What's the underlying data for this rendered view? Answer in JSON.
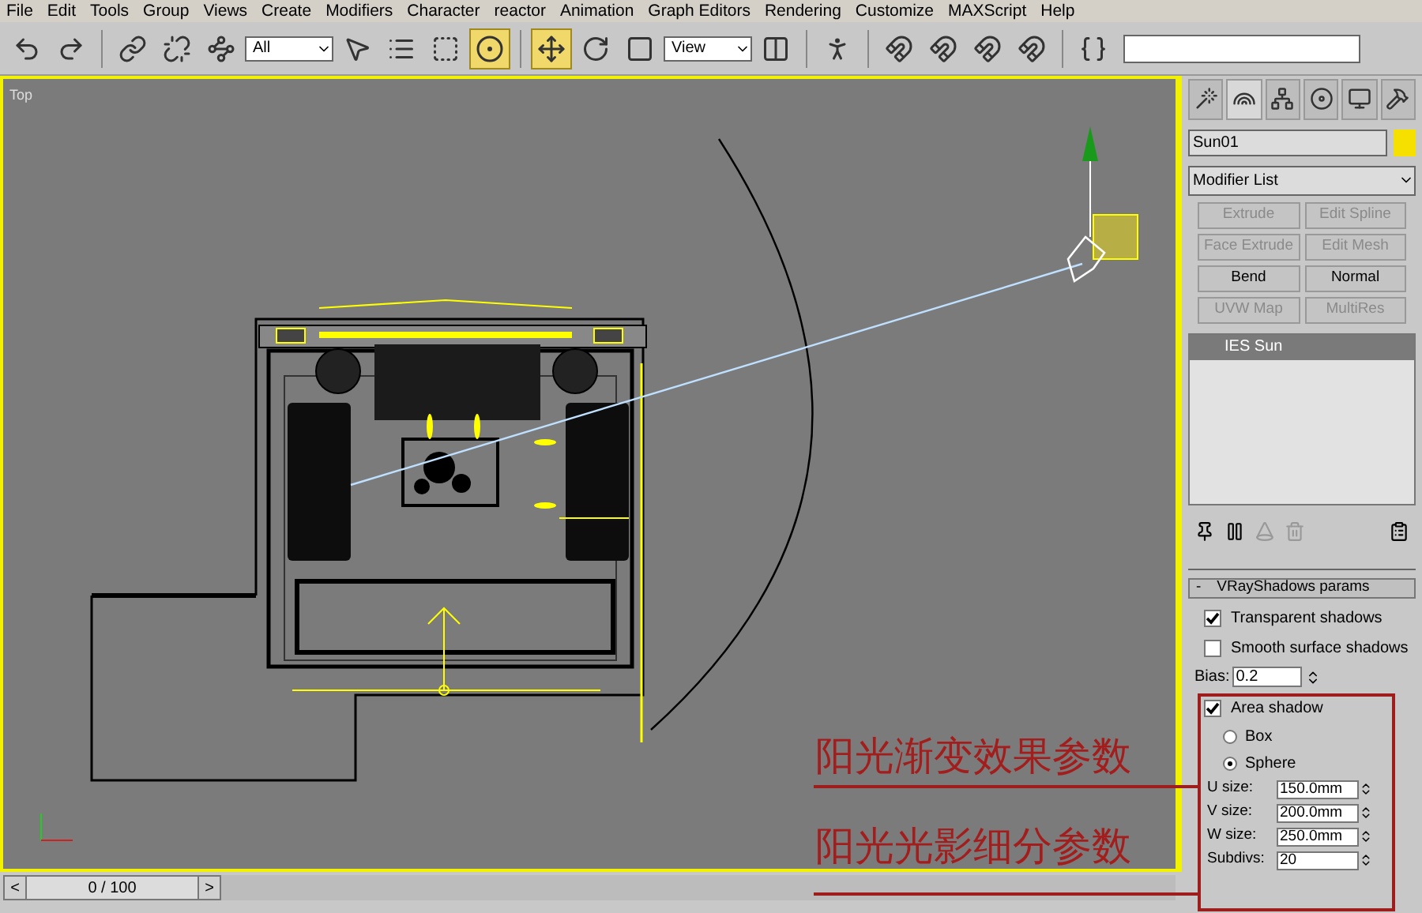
{
  "menu": [
    "File",
    "Edit",
    "Tools",
    "Group",
    "Views",
    "Create",
    "Modifiers",
    "Character",
    "reactor",
    "Animation",
    "Graph Editors",
    "Rendering",
    "Customize",
    "MAXScript",
    "Help"
  ],
  "toolbar": {
    "selection_filter": "All",
    "coordinate_system": "View"
  },
  "viewport": {
    "label": "Top"
  },
  "annotations": [
    "阳光渐变效果参数",
    "阳光光影细分参数"
  ],
  "command_panel": {
    "object_name": "Sun01",
    "modifier_list": "Modifier List",
    "modifier_buttons": [
      {
        "label": "Extrude",
        "disabled": true
      },
      {
        "label": "Edit Spline",
        "disabled": true
      },
      {
        "label": "Face Extrude",
        "disabled": true
      },
      {
        "label": "Edit Mesh",
        "disabled": true
      },
      {
        "label": "Bend",
        "disabled": false
      },
      {
        "label": "Normal",
        "disabled": false
      },
      {
        "label": "UVW Map",
        "disabled": true
      },
      {
        "label": "MultiRes",
        "disabled": true
      }
    ],
    "stack": [
      {
        "label": "IES Sun",
        "selected": true
      }
    ],
    "rollout": {
      "collapse": "-",
      "title": "VRayShadows params",
      "transparent_shadows": {
        "label": "Transparent shadows",
        "checked": true
      },
      "smooth_surface_shadows": {
        "label": "Smooth surface shadows",
        "checked": false
      },
      "bias": {
        "label": "Bias:",
        "value": "0.2"
      },
      "area_shadow": {
        "label": "Area shadow",
        "checked": true
      },
      "shapes": [
        {
          "label": "Box",
          "selected": false
        },
        {
          "label": "Sphere",
          "selected": true
        }
      ],
      "sizes": [
        {
          "label": "U size:",
          "value": "150.0mm"
        },
        {
          "label": "V size:",
          "value": "200.0mm"
        },
        {
          "label": "W size:",
          "value": "250.0mm"
        }
      ],
      "subdivs": {
        "label": "Subdivs:",
        "value": "20"
      }
    }
  },
  "timeline": {
    "prev": "<",
    "position": "0 / 100",
    "next": ">",
    "level": 0
  }
}
